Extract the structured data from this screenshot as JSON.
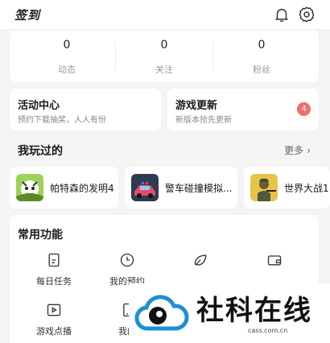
{
  "header": {
    "brand": "签到"
  },
  "stats": [
    {
      "value": "0",
      "label": "动态"
    },
    {
      "value": "0",
      "label": "关注"
    },
    {
      "value": "0",
      "label": "粉丝"
    }
  ],
  "features": [
    {
      "title": "活动中心",
      "subtitle": "预约下载抽奖，人人有份"
    },
    {
      "title": "游戏更新",
      "subtitle": "新版本抢先更新",
      "badge": "4"
    }
  ],
  "played": {
    "title": "我玩过的",
    "more": "更多",
    "games": [
      {
        "name": "帕特森的发明4"
      },
      {
        "name": "警车碰撞模拟..."
      },
      {
        "name": "世界大战1"
      }
    ]
  },
  "tools": {
    "title": "常用功能",
    "items": [
      {
        "label": "每日任务",
        "icon": "task-icon"
      },
      {
        "label": "我的预约",
        "icon": "clock-icon"
      },
      {
        "label": "",
        "icon": "leaf-icon"
      },
      {
        "label": "",
        "icon": "wallet-icon"
      },
      {
        "label": "游戏点播",
        "icon": "play-icon"
      },
      {
        "label": "我的",
        "icon": "phone-icon"
      }
    ]
  },
  "watermark": {
    "text": "社科在线",
    "url": "cass.com.cn"
  },
  "colors": {
    "badge": "#f56c6c",
    "background": "#f4f4f4",
    "card": "#ffffff"
  }
}
